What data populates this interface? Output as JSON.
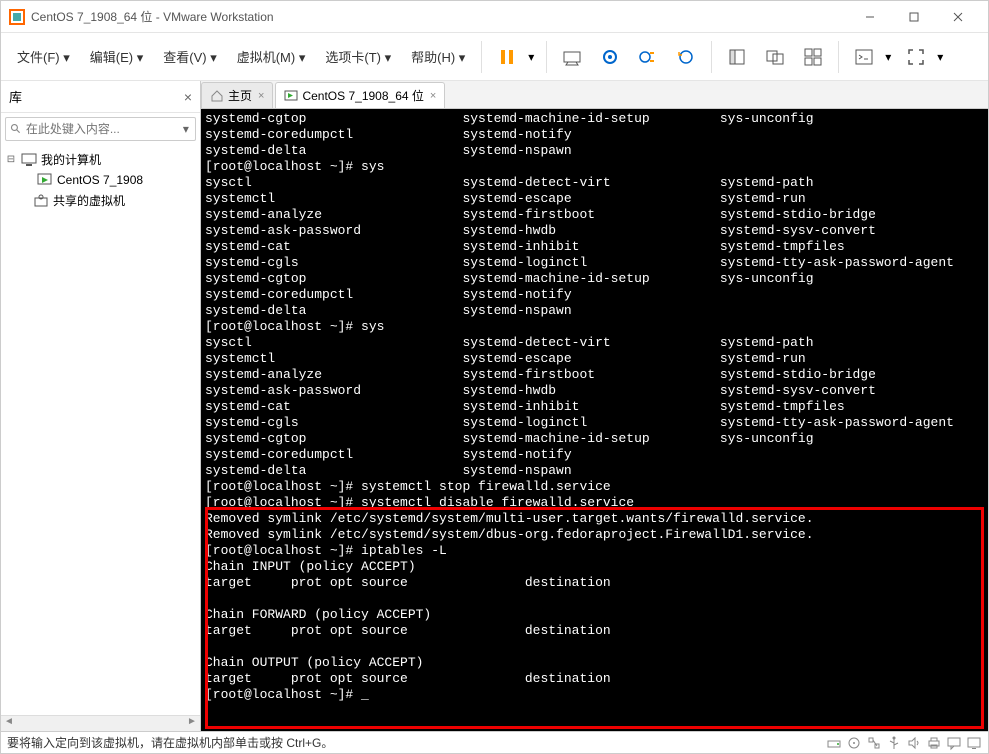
{
  "window": {
    "title": "CentOS 7_1908_64 位 - VMware Workstation"
  },
  "menu": {
    "file": "文件(F)",
    "edit": "编辑(E)",
    "view": "查看(V)",
    "vm": "虚拟机(M)",
    "tabs": "选项卡(T)",
    "help": "帮助(H)"
  },
  "sidebar": {
    "title": "库",
    "close": "×",
    "search_placeholder": "在此处键入内容...",
    "root": "我的计算机",
    "vm": "CentOS 7_1908",
    "shared": "共享的虚拟机"
  },
  "tabs": {
    "home": "主页",
    "vm": "CentOS 7_1908_64 位"
  },
  "terminal": {
    "lines": [
      "systemd-cgtop                    systemd-machine-id-setup         sys-unconfig",
      "systemd-coredumpctl              systemd-notify",
      "systemd-delta                    systemd-nspawn",
      "[root@localhost ~]# sys",
      "sysctl                           systemd-detect-virt              systemd-path",
      "systemctl                        systemd-escape                   systemd-run",
      "systemd-analyze                  systemd-firstboot                systemd-stdio-bridge",
      "systemd-ask-password             systemd-hwdb                     systemd-sysv-convert",
      "systemd-cat                      systemd-inhibit                  systemd-tmpfiles",
      "systemd-cgls                     systemd-loginctl                 systemd-tty-ask-password-agent",
      "systemd-cgtop                    systemd-machine-id-setup         sys-unconfig",
      "systemd-coredumpctl              systemd-notify",
      "systemd-delta                    systemd-nspawn",
      "[root@localhost ~]# sys",
      "sysctl                           systemd-detect-virt              systemd-path",
      "systemctl                        systemd-escape                   systemd-run",
      "systemd-analyze                  systemd-firstboot                systemd-stdio-bridge",
      "systemd-ask-password             systemd-hwdb                     systemd-sysv-convert",
      "systemd-cat                      systemd-inhibit                  systemd-tmpfiles",
      "systemd-cgls                     systemd-loginctl                 systemd-tty-ask-password-agent",
      "systemd-cgtop                    systemd-machine-id-setup         sys-unconfig",
      "systemd-coredumpctl              systemd-notify",
      "systemd-delta                    systemd-nspawn",
      "[root@localhost ~]# systemctl stop firewalld.service",
      "[root@localhost ~]# systemctl disable firewalld.service",
      "Removed symlink /etc/systemd/system/multi-user.target.wants/firewalld.service.",
      "Removed symlink /etc/systemd/system/dbus-org.fedoraproject.FirewallD1.service.",
      "[root@localhost ~]# iptables -L",
      "Chain INPUT (policy ACCEPT)",
      "target     prot opt source               destination",
      "",
      "Chain FORWARD (policy ACCEPT)",
      "target     prot opt source               destination",
      "",
      "Chain OUTPUT (policy ACCEPT)",
      "target     prot opt source               destination",
      "[root@localhost ~]# _"
    ]
  },
  "status": {
    "text": "要将输入定向到该虚拟机，请在虚拟机内部单击或按 Ctrl+G。"
  }
}
